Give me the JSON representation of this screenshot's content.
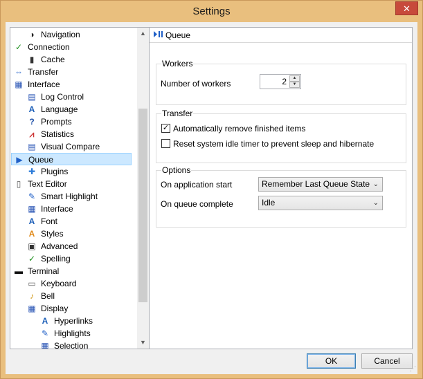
{
  "window": {
    "title": "Settings",
    "close_glyph": "✕"
  },
  "tree": {
    "items": [
      {
        "label": "Navigation",
        "icon": "navigation-icon",
        "indent": 1,
        "glyph": "◑",
        "color": "#222"
      },
      {
        "label": "Connection",
        "icon": "connection-icon",
        "indent": 0,
        "glyph": "✓",
        "color": "#1a8f1a"
      },
      {
        "label": "Cache",
        "icon": "cache-icon",
        "indent": 1,
        "glyph": "▮",
        "color": "#333"
      },
      {
        "label": "Transfer",
        "icon": "transfer-icon",
        "indent": 0,
        "glyph": "⇔",
        "color": "#1f5fc7"
      },
      {
        "label": "Interface",
        "icon": "interface-icon",
        "indent": 0,
        "glyph": "▦",
        "color": "#2a55b5"
      },
      {
        "label": "Log Control",
        "icon": "log-control-icon",
        "indent": 1,
        "glyph": "▤",
        "color": "#2a55b5"
      },
      {
        "label": "Language",
        "icon": "language-icon",
        "indent": 1,
        "glyph": "A",
        "color": "#1d5fb8"
      },
      {
        "label": "Prompts",
        "icon": "prompts-icon",
        "indent": 1,
        "glyph": "?",
        "color": "#1d4fa8"
      },
      {
        "label": "Statistics",
        "icon": "statistics-icon",
        "indent": 1,
        "glyph": "⩘",
        "color": "#c33"
      },
      {
        "label": "Visual Compare",
        "icon": "visual-compare-icon",
        "indent": 1,
        "glyph": "▤",
        "color": "#2a55b5"
      },
      {
        "label": "Queue",
        "icon": "queue-icon",
        "indent": 0,
        "glyph": "▶",
        "color": "#1f5fc7",
        "selected": true
      },
      {
        "label": "Plugins",
        "icon": "plugins-icon",
        "indent": 1,
        "glyph": "✚",
        "color": "#2a7ad8"
      },
      {
        "label": "Text Editor",
        "icon": "text-editor-icon",
        "indent": 0,
        "glyph": "▯",
        "color": "#555"
      },
      {
        "label": "Smart Highlight",
        "icon": "smart-highlight-icon",
        "indent": 1,
        "glyph": "✎",
        "color": "#1f5fc7"
      },
      {
        "label": "Interface",
        "icon": "interface-icon",
        "indent": 1,
        "glyph": "▦",
        "color": "#2a55b5"
      },
      {
        "label": "Font",
        "icon": "font-icon",
        "indent": 1,
        "glyph": "A",
        "color": "#1d5fb8"
      },
      {
        "label": "Styles",
        "icon": "styles-icon",
        "indent": 1,
        "glyph": "A",
        "color": "#e08a1a"
      },
      {
        "label": "Advanced",
        "icon": "advanced-icon",
        "indent": 1,
        "glyph": "▣",
        "color": "#333"
      },
      {
        "label": "Spelling",
        "icon": "spelling-icon",
        "indent": 1,
        "glyph": "✓",
        "color": "#1a8f1a"
      },
      {
        "label": "Terminal",
        "icon": "terminal-icon",
        "indent": 0,
        "glyph": "▬",
        "color": "#111"
      },
      {
        "label": "Keyboard",
        "icon": "keyboard-icon",
        "indent": 1,
        "glyph": "▭",
        "color": "#666"
      },
      {
        "label": "Bell",
        "icon": "bell-icon",
        "indent": 1,
        "glyph": "♪",
        "color": "#d19a1c"
      },
      {
        "label": "Display",
        "icon": "display-icon",
        "indent": 1,
        "glyph": "▦",
        "color": "#2a55b5"
      },
      {
        "label": "Hyperlinks",
        "icon": "hyperlinks-icon",
        "indent": 2,
        "glyph": "A",
        "color": "#1d5fb8"
      },
      {
        "label": "Highlights",
        "icon": "highlights-icon",
        "indent": 2,
        "glyph": "✎",
        "color": "#1f5fc7"
      },
      {
        "label": "Selection",
        "icon": "selection-icon",
        "indent": 2,
        "glyph": "▦",
        "color": "#2a55b5"
      }
    ]
  },
  "pane": {
    "header": "Queue",
    "workers": {
      "title": "Workers",
      "number_label": "Number of workers",
      "number_value": "2"
    },
    "transfer": {
      "title": "Transfer",
      "auto_remove_label": "Automatically remove finished items",
      "auto_remove_checked": true,
      "reset_idle_label": "Reset system idle timer to prevent sleep and hibernate",
      "reset_idle_checked": false
    },
    "options": {
      "title": "Options",
      "on_start_label": "On application start",
      "on_start_value": "Remember Last Queue State",
      "on_complete_label": "On queue complete",
      "on_complete_value": "Idle"
    }
  },
  "buttons": {
    "ok": "OK",
    "cancel": "Cancel"
  }
}
